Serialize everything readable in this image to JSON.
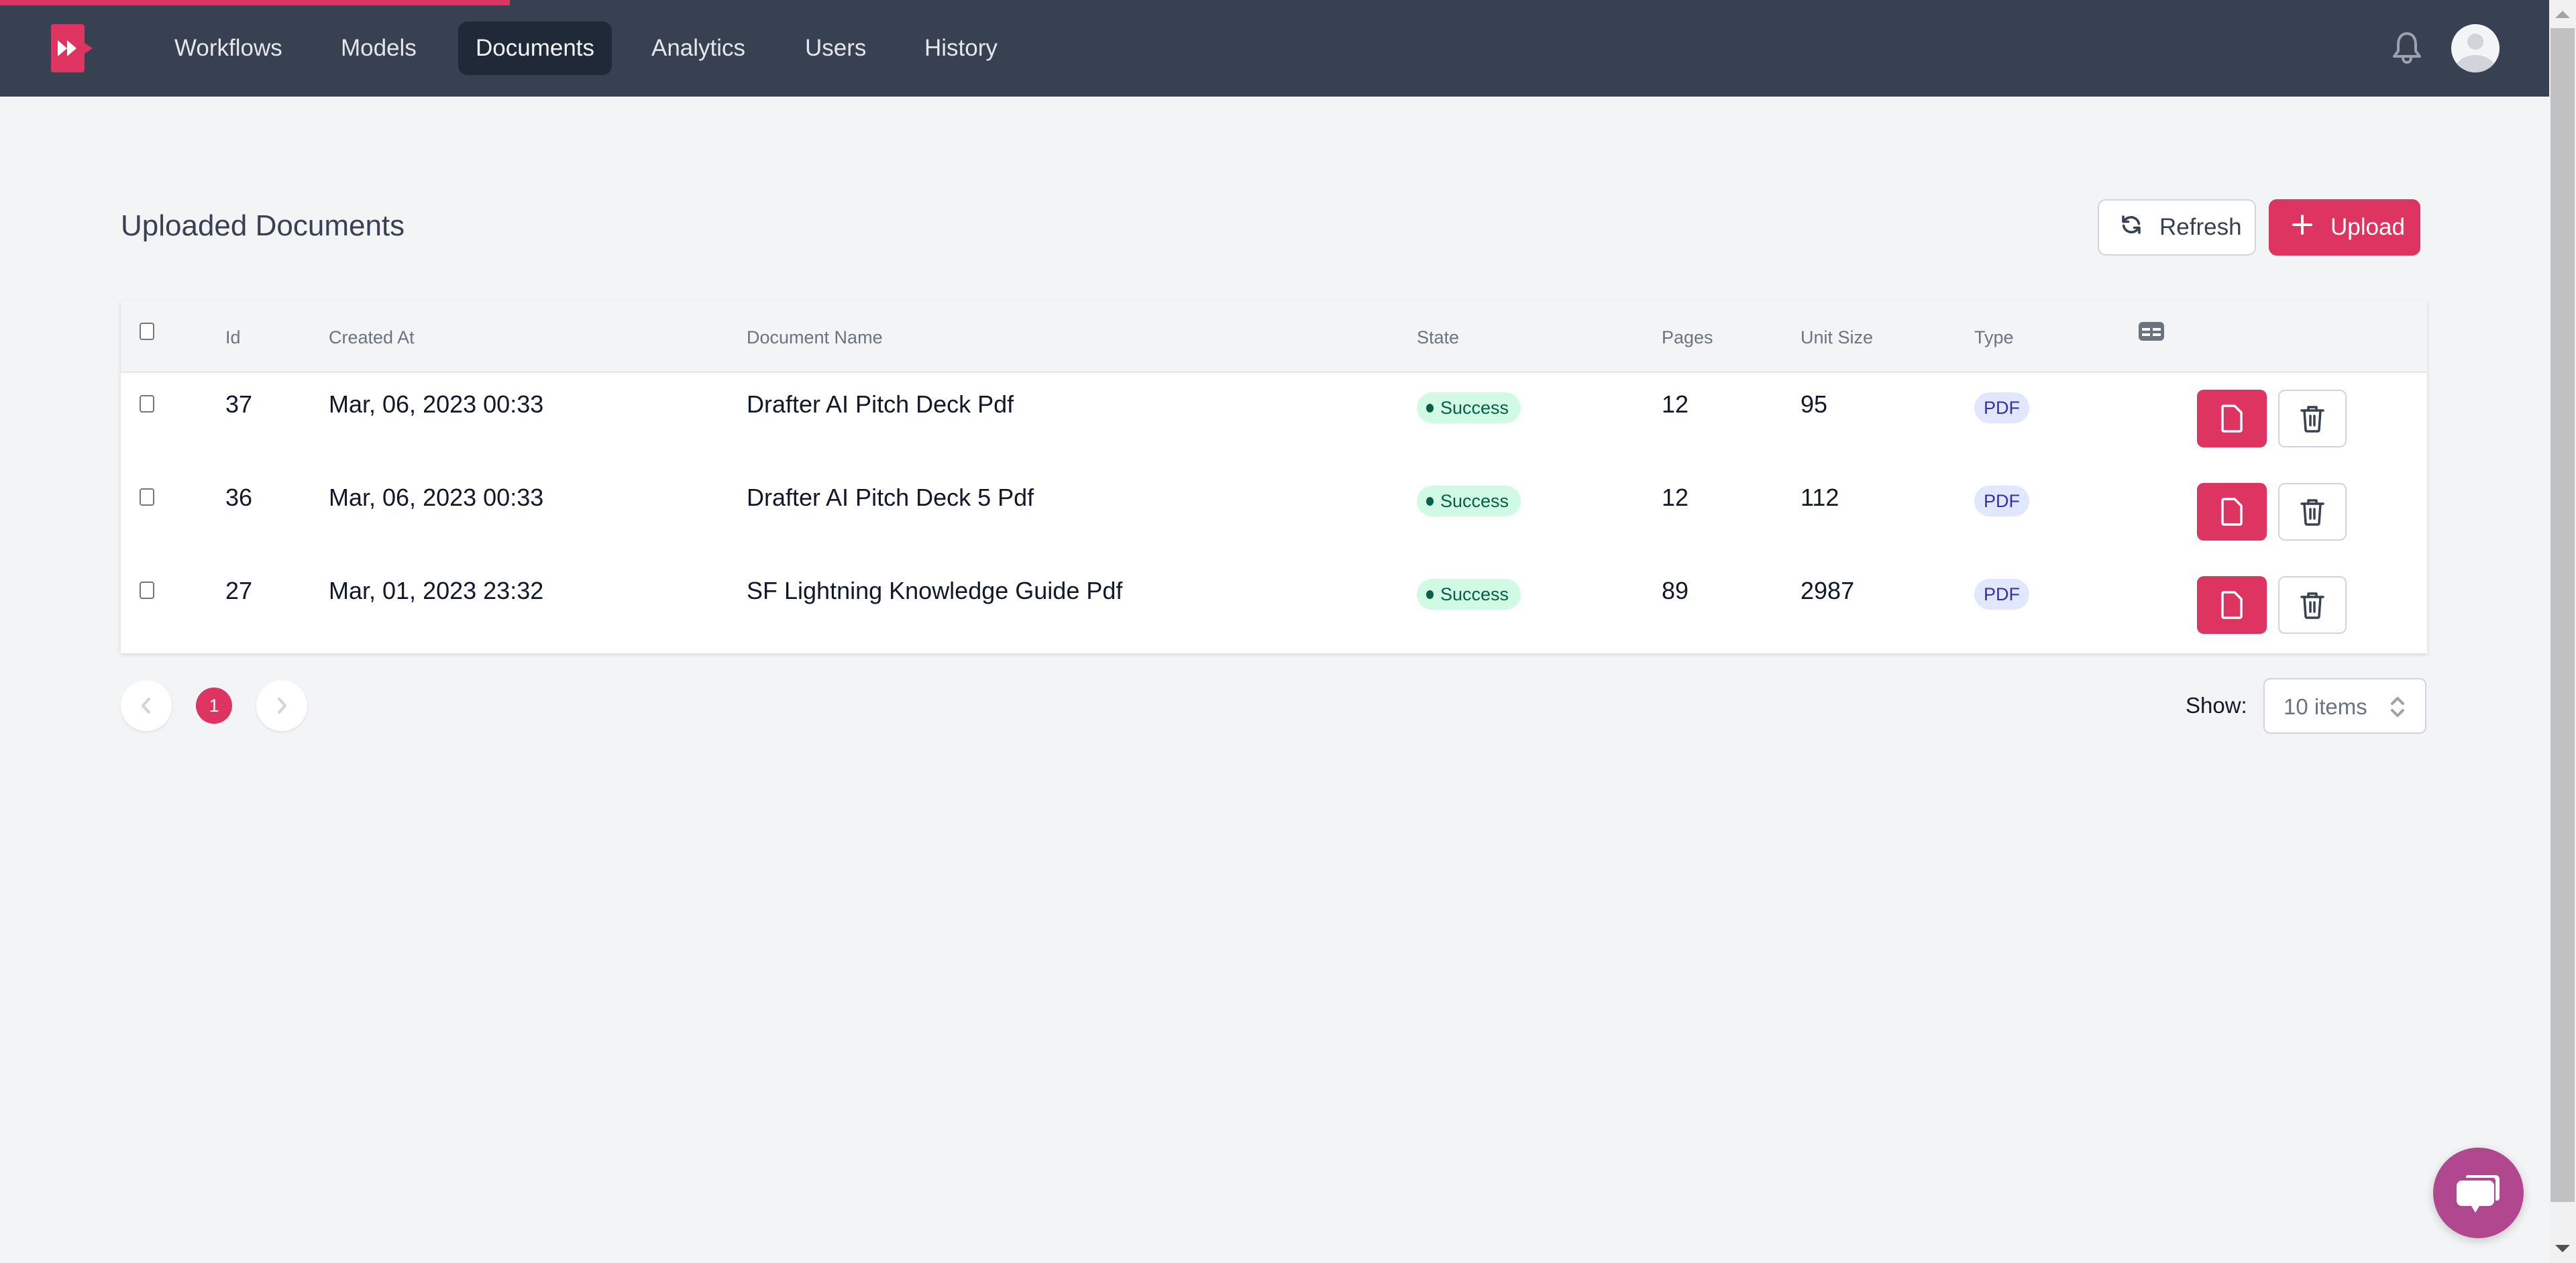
{
  "nav": {
    "logo": "app-logo",
    "items": [
      {
        "label": "Workflows",
        "active": false
      },
      {
        "label": "Models",
        "active": false
      },
      {
        "label": "Documents",
        "active": true
      },
      {
        "label": "Analytics",
        "active": false
      },
      {
        "label": "Users",
        "active": false
      },
      {
        "label": "History",
        "active": false
      }
    ],
    "notifications_icon": "bell-icon",
    "avatar_icon": "user-avatar-icon"
  },
  "page": {
    "title": "Uploaded Documents",
    "refresh_label": "Refresh",
    "upload_label": "Upload"
  },
  "table": {
    "columns": [
      "Id",
      "Created At",
      "Document Name",
      "State",
      "Pages",
      "Unit Size",
      "Type"
    ],
    "column_settings_icon": "table-columns-icon",
    "rows": [
      {
        "id": "37",
        "created_at": "Mar, 06, 2023 00:33",
        "name": "Drafter AI Pitch Deck Pdf",
        "state": "Success",
        "pages": "12",
        "unit_size": "95",
        "type": "PDF"
      },
      {
        "id": "36",
        "created_at": "Mar, 06, 2023 00:33",
        "name": "Drafter AI Pitch Deck 5 Pdf",
        "state": "Success",
        "pages": "12",
        "unit_size": "112",
        "type": "PDF"
      },
      {
        "id": "27",
        "created_at": "Mar, 01, 2023 23:32",
        "name": "SF Lightning Knowledge Guide Pdf",
        "state": "Success",
        "pages": "89",
        "unit_size": "2987",
        "type": "PDF"
      }
    ]
  },
  "pagination": {
    "current_page": "1",
    "show_label": "Show:",
    "page_size": "10 items"
  },
  "colors": {
    "brand": "#dd3461",
    "nav_bg": "#374151",
    "success_bg": "#d1fae5",
    "success_fg": "#065f46",
    "pdf_bg": "#e0e7ff",
    "pdf_fg": "#3730a3",
    "chat_fab": "#b0478f"
  }
}
